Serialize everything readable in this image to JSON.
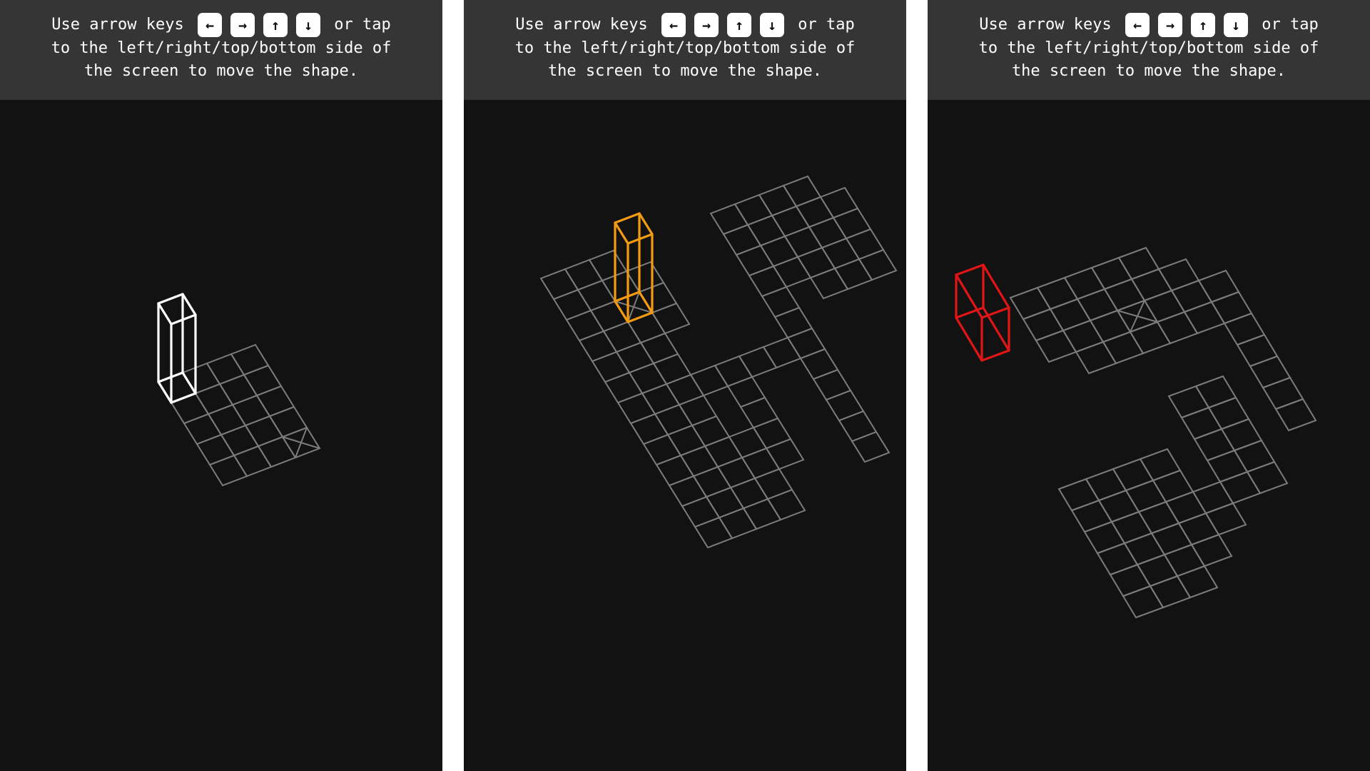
{
  "instructions": {
    "line1_pre": "Use arrow keys",
    "keys": [
      "←",
      "→",
      "↑",
      "↓"
    ],
    "line1_post": "or tap",
    "line2": "to the left/right/top/bottom side of",
    "line3": "the screen to move the shape."
  },
  "colors": {
    "background": "#121212",
    "header": "#353535",
    "grid": "#7c7c7c",
    "block_level1": "#ffffff",
    "block_level2": "#f39c12",
    "block_level3": "#e01515"
  },
  "levels": [
    {
      "block_color": "#ffffff",
      "block_orientation": "standing",
      "block_cells": [
        [
          0,
          0
        ]
      ],
      "goal": [
        4,
        3
      ],
      "tiles": [
        [
          0,
          0
        ],
        [
          0,
          1
        ],
        [
          0,
          2
        ],
        [
          0,
          3
        ],
        [
          1,
          0
        ],
        [
          1,
          1
        ],
        [
          1,
          2
        ],
        [
          1,
          3
        ],
        [
          2,
          0
        ],
        [
          2,
          1
        ],
        [
          2,
          2
        ],
        [
          2,
          3
        ],
        [
          3,
          0
        ],
        [
          3,
          1
        ],
        [
          3,
          2
        ],
        [
          3,
          3
        ],
        [
          4,
          0
        ],
        [
          4,
          1
        ],
        [
          4,
          2
        ],
        [
          4,
          3
        ]
      ]
    },
    {
      "block_color": "#f39c12",
      "block_orientation": "standing",
      "block_cells": [
        [
          2,
          2
        ]
      ],
      "goal": [
        2,
        2
      ],
      "tiles": [
        [
          0,
          0
        ],
        [
          0,
          1
        ],
        [
          0,
          2
        ],
        [
          1,
          0
        ],
        [
          1,
          1
        ],
        [
          1,
          2
        ],
        [
          1,
          3
        ],
        [
          2,
          0
        ],
        [
          2,
          1
        ],
        [
          2,
          2
        ],
        [
          2,
          3
        ],
        [
          3,
          0
        ],
        [
          3,
          1
        ],
        [
          3,
          2
        ],
        [
          3,
          3
        ],
        [
          4,
          0
        ],
        [
          4,
          1
        ],
        [
          4,
          2
        ],
        [
          5,
          0
        ],
        [
          5,
          1
        ],
        [
          5,
          2
        ],
        [
          6,
          0
        ],
        [
          6,
          1
        ],
        [
          6,
          2
        ],
        [
          6,
          3
        ],
        [
          7,
          0
        ],
        [
          7,
          1
        ],
        [
          7,
          2
        ],
        [
          8,
          0
        ],
        [
          8,
          1
        ],
        [
          8,
          2
        ],
        [
          9,
          0
        ],
        [
          9,
          1
        ],
        [
          9,
          2
        ],
        [
          10,
          0
        ],
        [
          10,
          1
        ],
        [
          10,
          2
        ],
        [
          10,
          3
        ],
        [
          10,
          4
        ],
        [
          11,
          0
        ],
        [
          11,
          1
        ],
        [
          11,
          2
        ],
        [
          11,
          3
        ],
        [
          12,
          0
        ],
        [
          12,
          1
        ],
        [
          12,
          2
        ],
        [
          12,
          3
        ],
        [
          9,
          3
        ],
        [
          9,
          4
        ],
        [
          8,
          4
        ],
        [
          7,
          4
        ],
        [
          6,
          4
        ],
        [
          6,
          5
        ],
        [
          6,
          6
        ],
        [
          6,
          7
        ],
        [
          7,
          7
        ],
        [
          8,
          7
        ],
        [
          9,
          7
        ],
        [
          10,
          7
        ],
        [
          11,
          7
        ],
        [
          5,
          7
        ],
        [
          4,
          7
        ],
        [
          3,
          7
        ],
        [
          2,
          7
        ],
        [
          1,
          7
        ],
        [
          0,
          7
        ],
        [
          0,
          8
        ],
        [
          1,
          8
        ],
        [
          2,
          8
        ],
        [
          3,
          8
        ],
        [
          0,
          9
        ],
        [
          1,
          9
        ],
        [
          2,
          9
        ],
        [
          3,
          9
        ],
        [
          4,
          9
        ],
        [
          0,
          10
        ],
        [
          1,
          10
        ],
        [
          2,
          10
        ],
        [
          3,
          10
        ],
        [
          4,
          10
        ],
        [
          1,
          11
        ],
        [
          2,
          11
        ],
        [
          3,
          11
        ],
        [
          4,
          11
        ]
      ]
    },
    {
      "block_color": "#e01515",
      "block_orientation": "lying",
      "block_cells": [
        [
          0,
          0
        ],
        [
          1,
          0
        ]
      ],
      "goal": [
        2,
        5
      ],
      "tiles": [
        [
          0,
          2
        ],
        [
          0,
          3
        ],
        [
          0,
          4
        ],
        [
          0,
          5
        ],
        [
          0,
          6
        ],
        [
          1,
          2
        ],
        [
          1,
          3
        ],
        [
          1,
          4
        ],
        [
          1,
          5
        ],
        [
          1,
          6
        ],
        [
          1,
          7
        ],
        [
          2,
          2
        ],
        [
          2,
          3
        ],
        [
          2,
          4
        ],
        [
          2,
          5
        ],
        [
          2,
          6
        ],
        [
          2,
          7
        ],
        [
          2,
          8
        ],
        [
          3,
          3
        ],
        [
          3,
          4
        ],
        [
          3,
          5
        ],
        [
          3,
          6
        ],
        [
          3,
          7
        ],
        [
          3,
          8
        ],
        [
          4,
          8
        ],
        [
          5,
          8
        ],
        [
          6,
          8
        ],
        [
          7,
          8
        ],
        [
          8,
          8
        ],
        [
          6,
          6
        ],
        [
          7,
          6
        ],
        [
          8,
          6
        ],
        [
          9,
          6
        ],
        [
          10,
          6
        ],
        [
          6,
          5
        ],
        [
          7,
          5
        ],
        [
          8,
          5
        ],
        [
          9,
          5
        ],
        [
          10,
          5
        ],
        [
          10,
          4
        ],
        [
          11,
          4
        ],
        [
          11,
          3
        ],
        [
          12,
          3
        ],
        [
          12,
          2
        ],
        [
          13,
          2
        ],
        [
          13,
          1
        ],
        [
          13,
          0
        ],
        [
          12,
          0
        ],
        [
          12,
          1
        ],
        [
          11,
          0
        ],
        [
          11,
          1
        ],
        [
          11,
          2
        ],
        [
          10,
          0
        ],
        [
          10,
          1
        ],
        [
          10,
          2
        ],
        [
          10,
          3
        ],
        [
          9,
          0
        ],
        [
          9,
          1
        ],
        [
          9,
          2
        ],
        [
          9,
          3
        ],
        [
          8,
          0
        ],
        [
          8,
          1
        ],
        [
          8,
          2
        ],
        [
          8,
          3
        ]
      ]
    }
  ]
}
